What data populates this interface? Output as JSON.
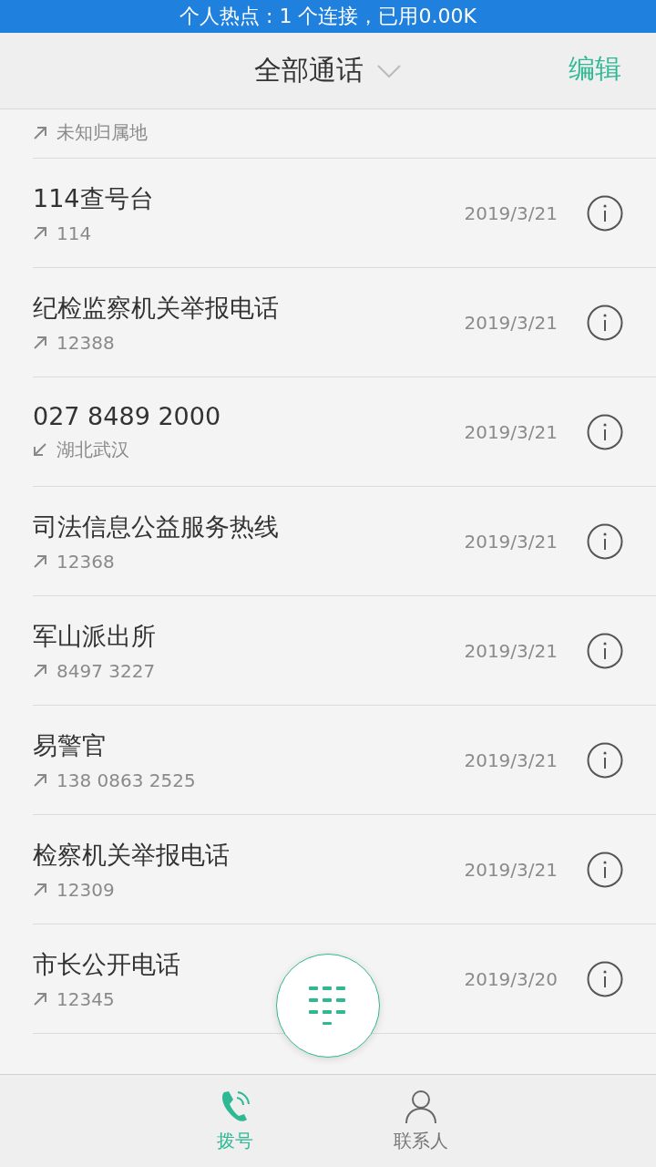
{
  "hotspot_banner": "个人热点 : 1 个连接，已用0.00K",
  "header": {
    "title": "全部通话",
    "edit": "编辑"
  },
  "calls": [
    {
      "kind": "outgoing",
      "detail": "未知归属地"
    },
    {
      "name": "114查号台",
      "kind": "outgoing",
      "detail": "114",
      "date": "2019/3/21"
    },
    {
      "name": "纪检监察机关举报电话",
      "kind": "outgoing",
      "detail": "12388",
      "date": "2019/3/21"
    },
    {
      "name": "027 8489 2000",
      "kind": "incoming",
      "detail": "湖北武汉",
      "date": "2019/3/21"
    },
    {
      "name": "司法信息公益服务热线",
      "kind": "outgoing",
      "detail": "12368",
      "date": "2019/3/21"
    },
    {
      "name": "军山派出所",
      "kind": "outgoing",
      "detail": "8497 3227",
      "date": "2019/3/21"
    },
    {
      "name": "易警官",
      "kind": "outgoing",
      "detail": "138 0863 2525",
      "date": "2019/3/21"
    },
    {
      "name": "检察机关举报电话",
      "kind": "outgoing",
      "detail": "12309",
      "date": "2019/3/21"
    },
    {
      "name": "市长公开电话",
      "kind": "outgoing",
      "detail": "12345",
      "date": "2019/3/20"
    }
  ],
  "tabs": [
    {
      "label": "拨号",
      "selected": true
    },
    {
      "label": "联系人",
      "selected": false
    }
  ]
}
